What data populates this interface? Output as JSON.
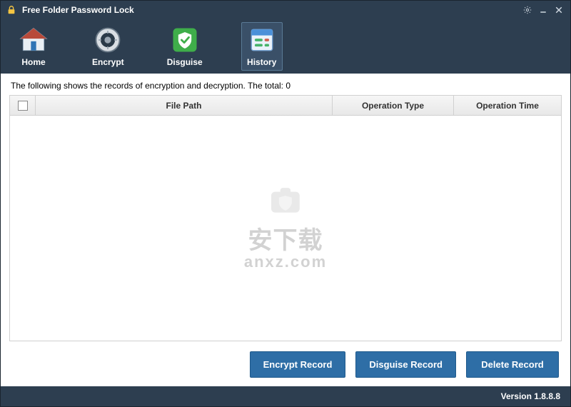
{
  "window": {
    "title": "Free Folder Password Lock"
  },
  "toolbar": {
    "home": "Home",
    "encrypt": "Encrypt",
    "disguise": "Disguise",
    "history": "History"
  },
  "main": {
    "description_prefix": "The following shows the records of encryption and decryption. The total: ",
    "total_count": "0",
    "columns": {
      "filepath": "File Path",
      "operation_type": "Operation Type",
      "operation_time": "Operation Time"
    },
    "rows": []
  },
  "watermark": {
    "line1": "安下载",
    "line2": "anxz.com"
  },
  "actions": {
    "encrypt_record": "Encrypt Record",
    "disguise_record": "Disguise Record",
    "delete_record": "Delete Record"
  },
  "status": {
    "version_label": "Version ",
    "version_value": "1.8.8.8"
  }
}
